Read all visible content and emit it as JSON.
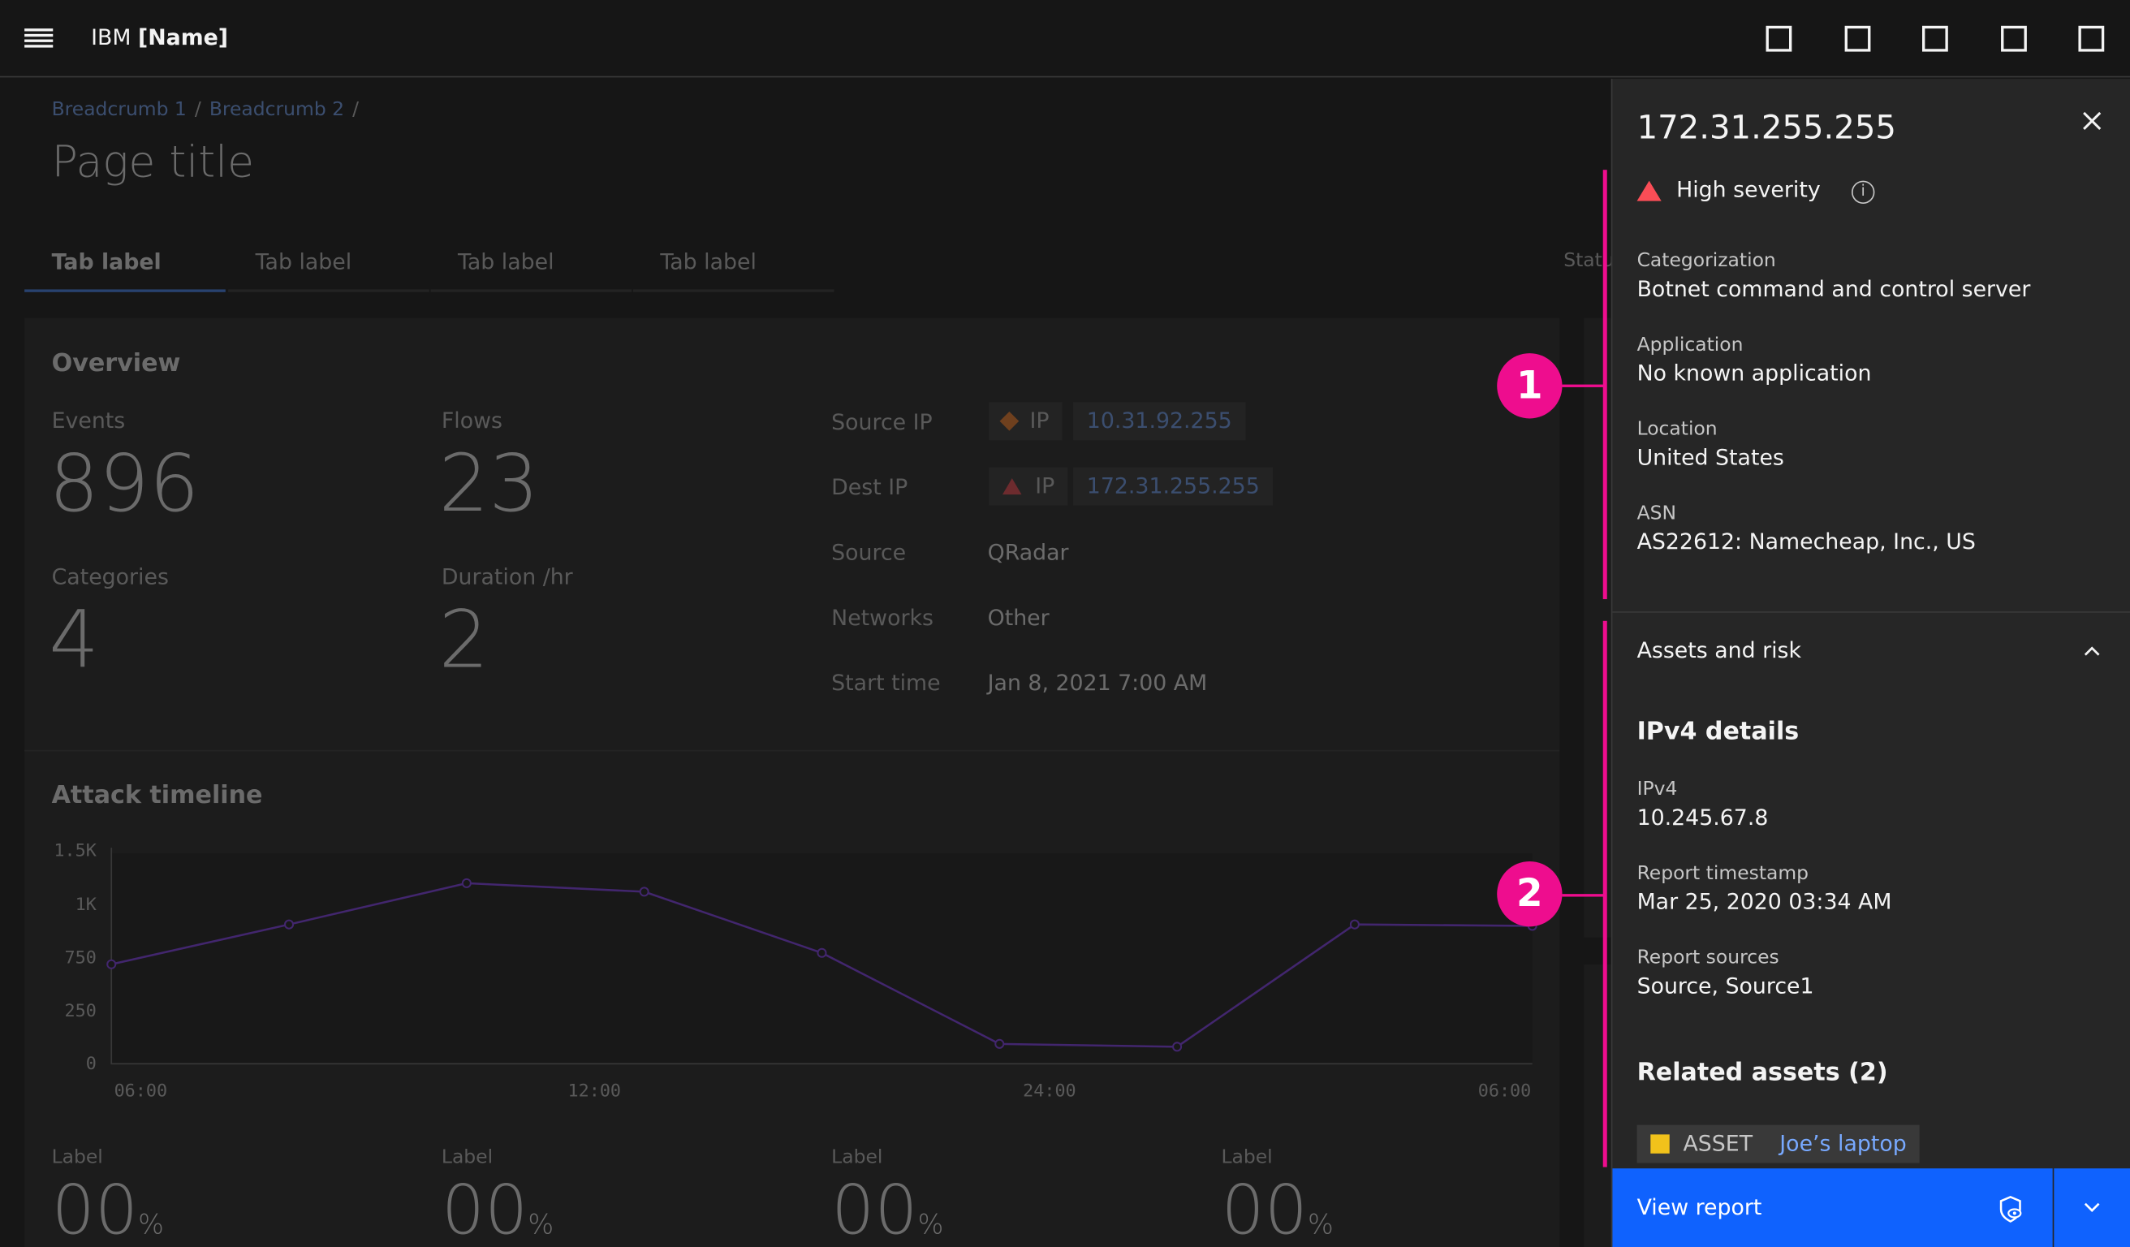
{
  "header": {
    "brand_prefix": "IBM",
    "brand_name": "[Name]",
    "icons": [
      "app-icon-1",
      "app-icon-2",
      "app-icon-3",
      "app-icon-4",
      "app-icon-5"
    ]
  },
  "breadcrumb": {
    "items": [
      "Breadcrumb 1",
      "Breadcrumb 2"
    ],
    "separator": "/"
  },
  "page": {
    "title": "Page title"
  },
  "tabs": [
    {
      "label": "Tab label"
    },
    {
      "label": "Tab label"
    },
    {
      "label": "Tab label"
    },
    {
      "label": "Tab label"
    }
  ],
  "status_partial": "Statu",
  "overview": {
    "title": "Overview",
    "metrics": [
      {
        "label": "Events",
        "value": "896"
      },
      {
        "label": "Flows",
        "value": "23"
      },
      {
        "label": "Categories",
        "value": "4"
      },
      {
        "label": "Duration /hr",
        "value": "2"
      }
    ],
    "details": [
      {
        "label": "Source IP",
        "tag": "IP",
        "value": "10.31.92.255",
        "icon": "diamond-icon",
        "color": "#ff832b"
      },
      {
        "label": "Dest IP",
        "tag": "IP",
        "value": "172.31.255.255",
        "icon": "warning-triangle-icon",
        "color": "#fa4d56"
      },
      {
        "label": "Source",
        "value": "QRadar"
      },
      {
        "label": "Networks",
        "value": "Other"
      },
      {
        "label": "Start time",
        "value": "Jan 8, 2021 7:00 AM"
      }
    ]
  },
  "attack_timeline": {
    "title": "Attack timeline"
  },
  "chart_data": {
    "type": "line",
    "title": "Attack timeline",
    "ylim": [
      0,
      1500
    ],
    "y_ticks": [
      "1.5K",
      "1K",
      "750",
      "250",
      "0"
    ],
    "x_tick_labels": [
      "06:00",
      "12:00",
      "24:00",
      "06:00"
    ],
    "series": [
      {
        "values": [
          700,
          980,
          1270,
          1210,
          780,
          140,
          120,
          980,
          970
        ]
      }
    ],
    "color": "#8a3ffc"
  },
  "bottom_metrics": [
    {
      "label": "Label",
      "value": "00",
      "unit": "%"
    },
    {
      "label": "Label",
      "value": "00",
      "unit": "%"
    },
    {
      "label": "Label",
      "value": "00",
      "unit": "%"
    },
    {
      "label": "Label",
      "value": "00",
      "unit": "%"
    }
  ],
  "panel": {
    "ip": "172.31.255.255",
    "severity": "High severity",
    "info_glyph": "i",
    "fields": [
      {
        "label": "Categorization",
        "value": "Botnet command and control server"
      },
      {
        "label": "Application",
        "value": "No known  application"
      },
      {
        "label": "Location",
        "value": "United States"
      },
      {
        "label": "ASN",
        "value": "AS22612: Namecheap, Inc., US"
      }
    ],
    "accordion_title": "Assets and risk",
    "ipv4_title": "IPv4 details",
    "ipv4_fields": [
      {
        "label": "IPv4",
        "value": "10.245.67.8"
      },
      {
        "label": "Report timestamp",
        "value": "Mar 25, 2020 03:34 AM"
      },
      {
        "label": "Report sources",
        "value": "Source, Source1"
      }
    ],
    "related_title": "Related assets (2)",
    "asset_tag": "ASSET",
    "asset_link": "Joe’s laptop",
    "view_report": "View report"
  },
  "markers": [
    "1",
    "2"
  ],
  "colors": {
    "accent": "#0f62fe",
    "marker": "#ee0d8e",
    "warning": "#fa4d56",
    "asset": "#f1c21b",
    "line": "#8a3ffc"
  }
}
